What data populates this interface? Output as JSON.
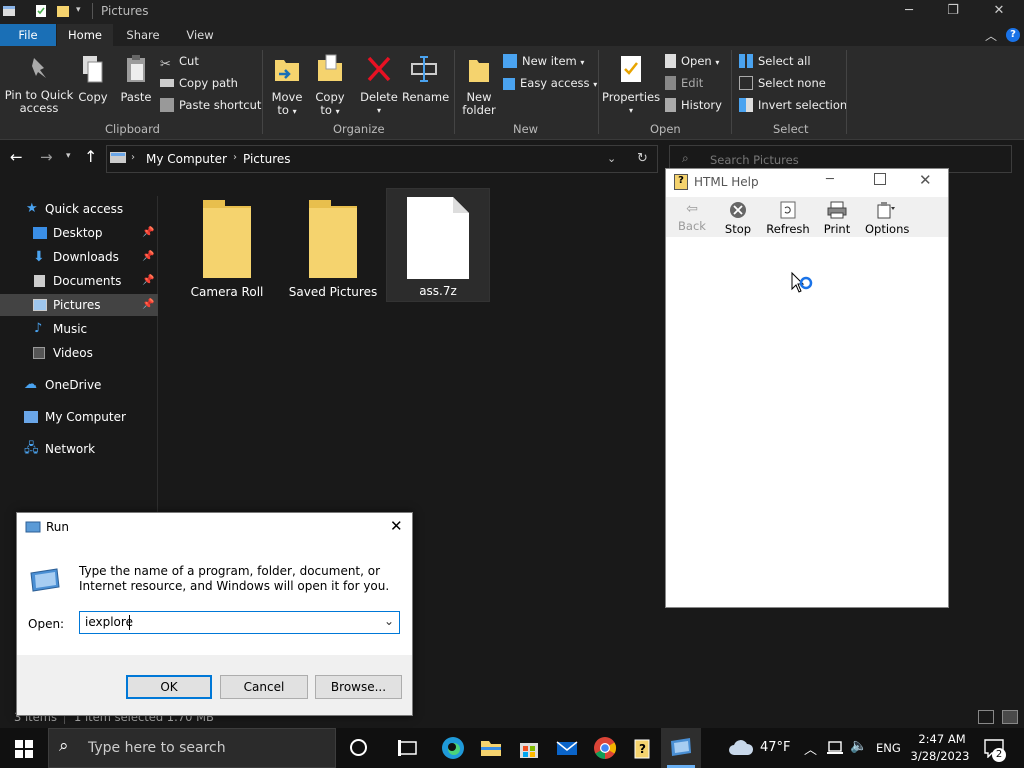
{
  "explorer": {
    "title": "Pictures",
    "tabs": {
      "file": "File",
      "home": "Home",
      "share": "Share",
      "view": "View"
    },
    "ribbon": {
      "clipboard": {
        "label": "Clipboard",
        "pin_line1": "Pin to Quick",
        "pin_line2": "access",
        "copy": "Copy",
        "paste": "Paste",
        "cut": "Cut",
        "copy_path": "Copy path",
        "paste_shortcut": "Paste shortcut"
      },
      "organize": {
        "label": "Organize",
        "move_to_line1": "Move",
        "move_to_line2": "to",
        "copy_to_line1": "Copy",
        "copy_to_line2": "to",
        "delete": "Delete",
        "rename": "Rename"
      },
      "new": {
        "label": "New",
        "new_folder_line1": "New",
        "new_folder_line2": "folder",
        "new_item": "New item",
        "easy_access": "Easy access"
      },
      "open": {
        "label": "Open",
        "properties": "Properties",
        "open": "Open",
        "edit": "Edit",
        "history": "History"
      },
      "select": {
        "label": "Select",
        "select_all": "Select all",
        "select_none": "Select none",
        "invert_selection": "Invert selection"
      }
    },
    "address": {
      "crumb1": "My Computer",
      "crumb2": "Pictures"
    },
    "search_placeholder": "Search Pictures",
    "nav": {
      "quick_access": "Quick access",
      "desktop": "Desktop",
      "downloads": "Downloads",
      "documents": "Documents",
      "pictures": "Pictures",
      "music": "Music",
      "videos": "Videos",
      "onedrive": "OneDrive",
      "my_computer": "My Computer",
      "network": "Network"
    },
    "files": [
      {
        "name": "Camera Roll"
      },
      {
        "name": "Saved Pictures"
      },
      {
        "name": "ass.7z"
      }
    ],
    "status": {
      "items": "3 items",
      "selected": "1 item selected  1.70 MB"
    }
  },
  "htmlhelp": {
    "title": "HTML Help",
    "back": "Back",
    "stop": "Stop",
    "refresh": "Refresh",
    "print": "Print",
    "options": "Options"
  },
  "run": {
    "title": "Run",
    "description": "Type the name of a program, folder, document, or Internet resource, and Windows will open it for you.",
    "open_label": "Open:",
    "open_value": "iexplore",
    "ok": "OK",
    "cancel": "Cancel",
    "browse": "Browse..."
  },
  "taskbar": {
    "search_placeholder": "Type here to search",
    "weather": "47°F",
    "lang": "ENG",
    "time": "2:47 AM",
    "date": "3/28/2023",
    "notifications": "2"
  },
  "colors": {
    "accent": "#1a6fb6",
    "folder": "#f5d36e",
    "dark_bg": "#191919"
  }
}
